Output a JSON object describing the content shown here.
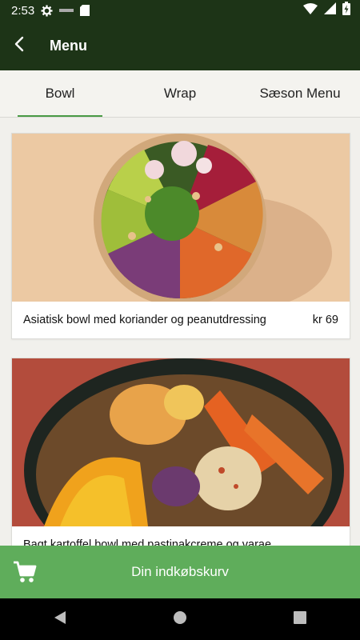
{
  "status": {
    "time": "2:53"
  },
  "appbar": {
    "title": "Menu"
  },
  "tabs": [
    {
      "label": "Bowl",
      "active": true
    },
    {
      "label": "Wrap",
      "active": false
    },
    {
      "label": "Sæson Menu",
      "active": false
    }
  ],
  "items": [
    {
      "name": "Asiatisk bowl med koriander og peanutdressing",
      "price": "kr 69"
    },
    {
      "name": "Bagt kartoffel bowl med pastinakcreme og varae",
      "price": ""
    }
  ],
  "cart": {
    "label": "Din indkøbskurv"
  },
  "colors": {
    "primary_dark": "#1d3417",
    "accent_green": "#5fad5b",
    "tab_indicator": "#4a9a45"
  }
}
